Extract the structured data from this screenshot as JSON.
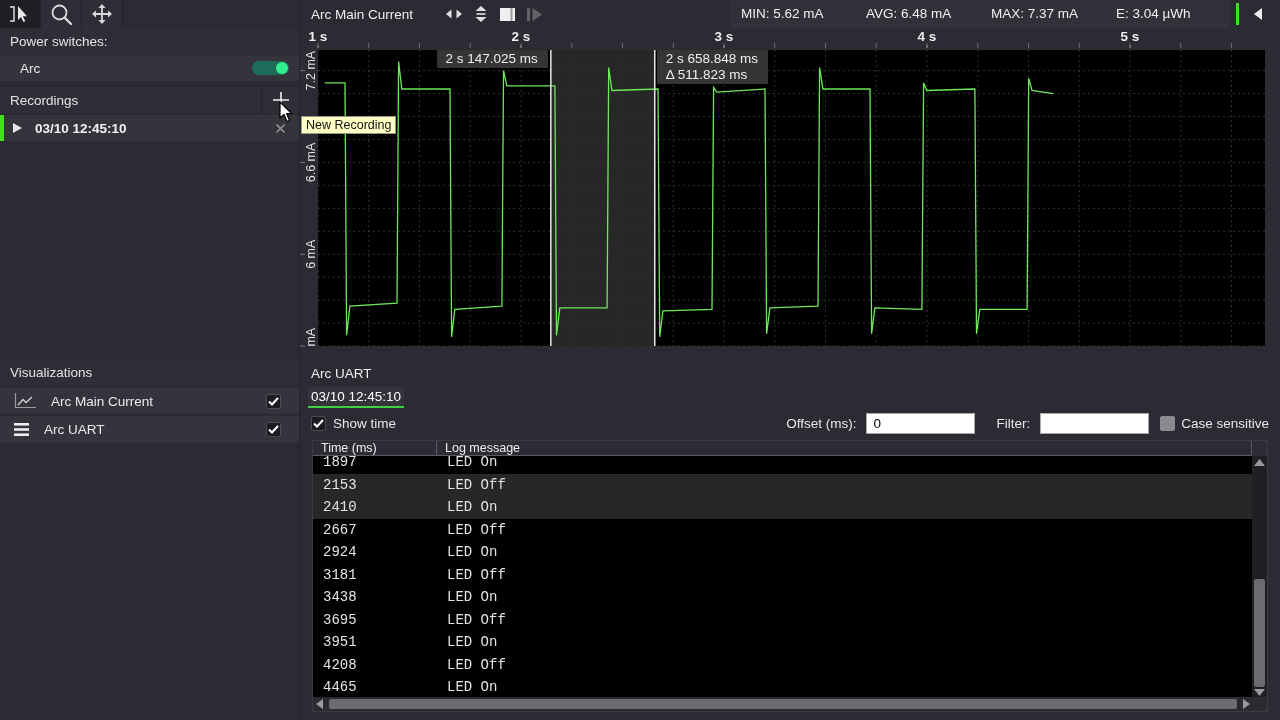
{
  "sidebar": {
    "tools": [
      {
        "kind": "select",
        "selected": true
      },
      {
        "kind": "zoom",
        "selected": false
      },
      {
        "kind": "pan",
        "selected": false
      }
    ],
    "power_switches": {
      "title": "Power switches:",
      "items": [
        {
          "label": "Arc",
          "on": true
        }
      ]
    },
    "recordings": {
      "title": "Recordings",
      "add_tooltip": "New Recording",
      "items": [
        {
          "label": "03/10 12:45:10",
          "selected": true,
          "expanded": false
        }
      ]
    },
    "visualizations": {
      "title": "Visualizations",
      "items": [
        {
          "kind": "chart",
          "label": "Arc Main Current",
          "checked": true
        },
        {
          "kind": "log",
          "label": "Arc UART",
          "checked": true
        }
      ]
    }
  },
  "chart_panel": {
    "title": "Arc Main Current",
    "controls": [
      {
        "kind": "horizontal",
        "disabled": false
      },
      {
        "kind": "vertical",
        "disabled": false
      },
      {
        "kind": "square",
        "disabled": false
      },
      {
        "kind": "step",
        "disabled": true
      }
    ],
    "stats": [
      "MIN: 5.62 mA",
      "AVG: 6.48 mA",
      "MAX: 7.37 mA",
      "E: 3.04 µWh"
    ],
    "chart_data": {
      "type": "line",
      "x": [
        1.034,
        1.133,
        1.141,
        1.157,
        1.389,
        1.397,
        1.413,
        1.65,
        1.658,
        1.674,
        1.906,
        1.914,
        1.93,
        2.167,
        2.175,
        2.191,
        2.424,
        2.432,
        2.448,
        2.675,
        2.683,
        2.699,
        2.941,
        2.949,
        2.965,
        3.202,
        3.21,
        3.226,
        3.463,
        3.471,
        3.487,
        3.719,
        3.727,
        3.743,
        3.975,
        3.983,
        3.999,
        4.236,
        4.244,
        4.26,
        4.493,
        4.501,
        4.517,
        4.621
      ],
      "series": [
        {
          "color": "#6ee85a",
          "values": [
            7.12,
            7.12,
            5.47,
            5.66,
            5.68,
            7.26,
            7.08,
            7.08,
            5.46,
            5.64,
            5.66,
            7.2,
            7.1,
            7.1,
            5.47,
            5.65,
            5.65,
            7.22,
            7.07,
            7.08,
            5.46,
            5.63,
            5.64,
            7.09,
            7.06,
            7.08,
            5.48,
            5.65,
            5.66,
            7.22,
            7.08,
            7.08,
            5.48,
            5.65,
            5.64,
            7.12,
            7.07,
            7.08,
            5.48,
            5.64,
            5.64,
            7.15,
            7.07,
            7.05
          ]
        }
      ],
      "xlim": [
        1.0,
        5.665
      ],
      "ylim": [
        5.4,
        7.335
      ],
      "grid": true,
      "xticks": [
        {
          "value": 1,
          "label": "1 s"
        },
        {
          "value": 2,
          "label": "2 s"
        },
        {
          "value": 3,
          "label": "3 s"
        },
        {
          "value": 4,
          "label": "4 s"
        },
        {
          "value": 5,
          "label": "5 s"
        }
      ],
      "yticks": [
        {
          "value": 7.2,
          "label": "7.2 mA"
        },
        {
          "value": 6.6,
          "label": "6.6 mA"
        },
        {
          "value": 6,
          "label": "6 mA"
        },
        {
          "value": 5.4,
          "label": "mA"
        }
      ],
      "ref_lines": [
        {
          "axis": "x",
          "value": 2.147,
          "label": "2 s 147.025 ms",
          "color": "#e8e8e8"
        },
        {
          "axis": "x",
          "value": 2.659,
          "label": "2 s 658.848 ms",
          "color": "#e8e8e8"
        }
      ],
      "bands": [
        {
          "axis": "x",
          "from": 2.147,
          "to": 2.659,
          "label": "Δ 511.823 ms",
          "color": "#272727"
        }
      ]
    }
  },
  "log_panel": {
    "title": "Arc UART",
    "tabs": [
      {
        "label": "03/10 12:45:10",
        "selected": true
      }
    ],
    "show_time": {
      "label": "Show time",
      "checked": true
    },
    "offset": {
      "label": "Offset (ms):",
      "value": "0"
    },
    "filter": {
      "label": "Filter:"
    },
    "case_sensitive": {
      "label": "Case sensitive",
      "checked": false
    },
    "table": {
      "columns": [
        "Time (ms)",
        "Log message"
      ],
      "rows": [
        {
          "time": "1897",
          "message": "LED On",
          "selected": false
        },
        {
          "time": "2153",
          "message": "LED Off",
          "selected": true
        },
        {
          "time": "2410",
          "message": "LED On",
          "selected": true
        },
        {
          "time": "2667",
          "message": "LED Off",
          "selected": false
        },
        {
          "time": "2924",
          "message": "LED On",
          "selected": false
        },
        {
          "time": "3181",
          "message": "LED Off",
          "selected": false
        },
        {
          "time": "3438",
          "message": "LED On",
          "selected": false
        },
        {
          "time": "3695",
          "message": "LED Off",
          "selected": false
        },
        {
          "time": "3951",
          "message": "LED On",
          "selected": false
        },
        {
          "time": "4208",
          "message": "LED Off",
          "selected": false
        },
        {
          "time": "4465",
          "message": "LED On",
          "selected": false
        }
      ]
    }
  }
}
